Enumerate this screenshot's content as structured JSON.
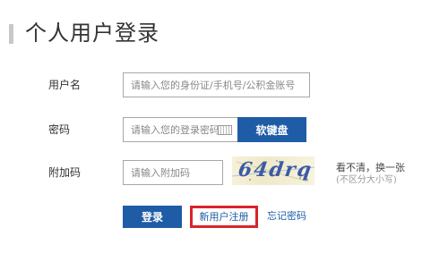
{
  "page_title": "个人用户登录",
  "username": {
    "label": "用户名",
    "placeholder": "请输入您的身份证/手机号/公积金账号"
  },
  "password": {
    "label": "密码",
    "placeholder": "请输入您的登录密码",
    "keyboard_button": "软键盘"
  },
  "captcha": {
    "label": "附加码",
    "placeholder": "请输入附加码",
    "image_text": "64drq",
    "refresh_link": "看不清，换一张",
    "hint": "(不区分大小写)"
  },
  "actions": {
    "login": "登录",
    "register": "新用户注册",
    "forgot_password": "忘记密码"
  },
  "colors": {
    "primary": "#1f5ca6",
    "highlight": "#d8242b"
  }
}
